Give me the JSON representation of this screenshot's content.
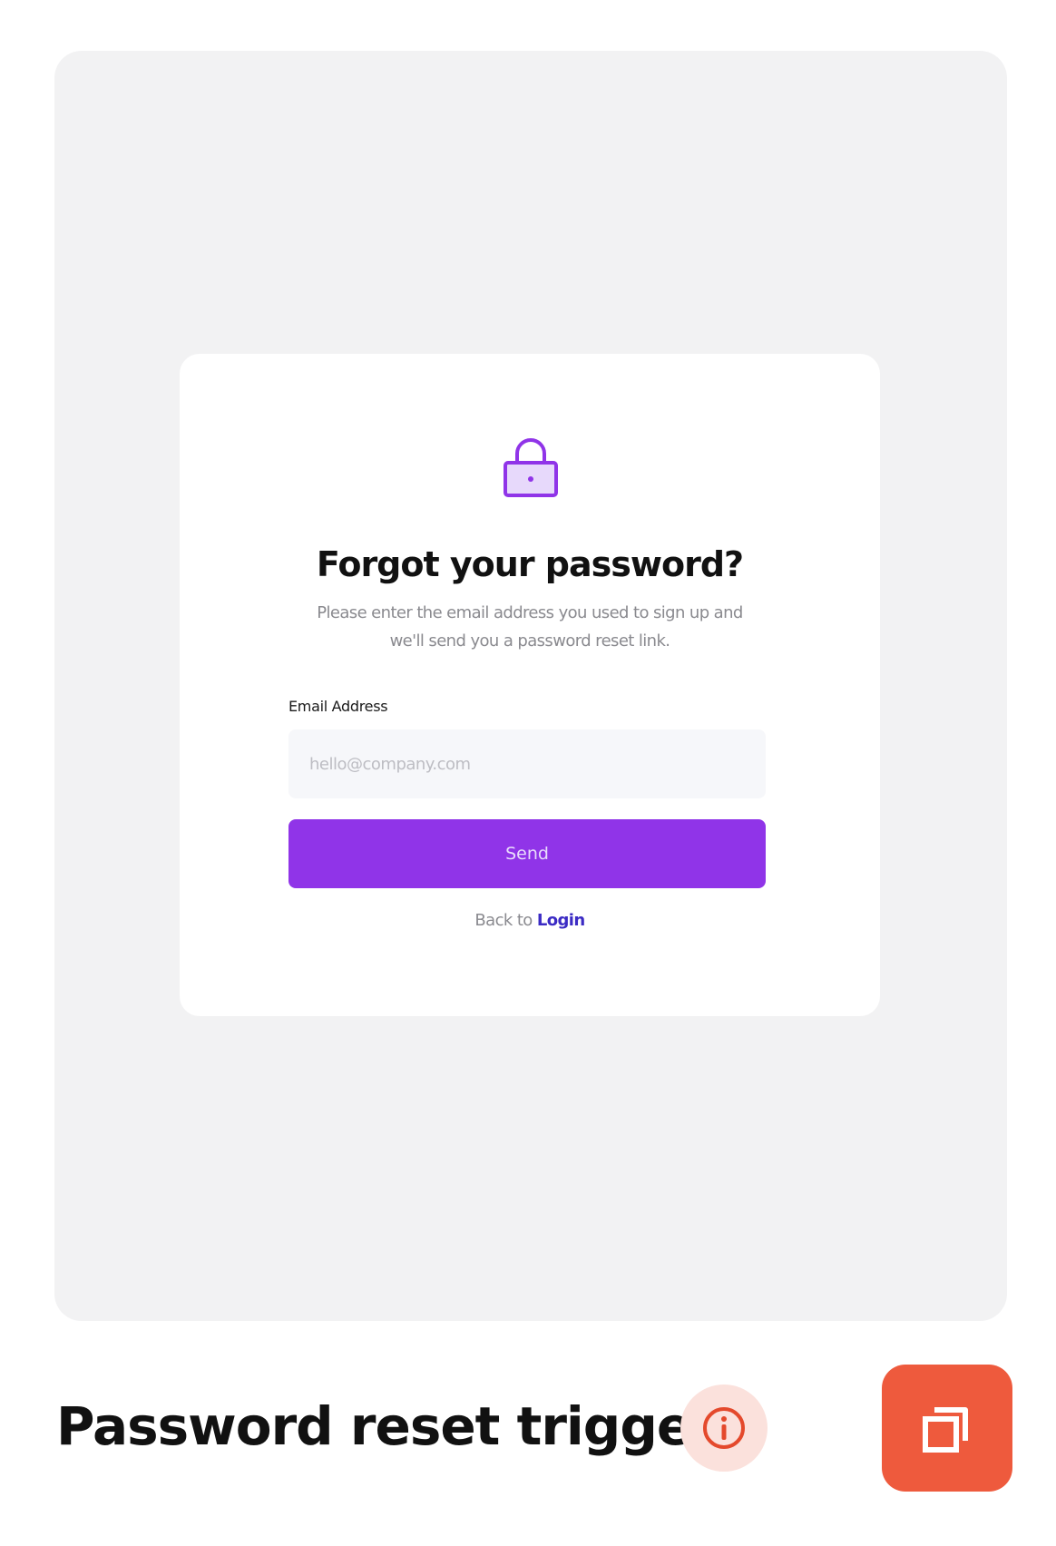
{
  "card": {
    "title": "Forgot your password?",
    "subtitle_line1": "Please enter the email address you used to sign up and",
    "subtitle_line2": "we'll send you a password reset link.",
    "email_label": "Email Address",
    "email_placeholder": "hello@company.com",
    "email_value": "",
    "send_label": "Send",
    "back_prefix": "Back to",
    "login_label": "Login",
    "lock_icon": "lock-icon"
  },
  "footer": {
    "title": "Password reset trigger",
    "info_icon": "info-icon",
    "copy_icon": "copy-icon"
  },
  "colors": {
    "panel_background": "#f2f2f3",
    "card_background": "#ffffff",
    "accent_purple": "#9034e8",
    "link_color": "#3b2bc4",
    "copy_button": "#ee5a3d",
    "info_badge": "#fbe1dc",
    "info_icon": "#e4492c"
  }
}
